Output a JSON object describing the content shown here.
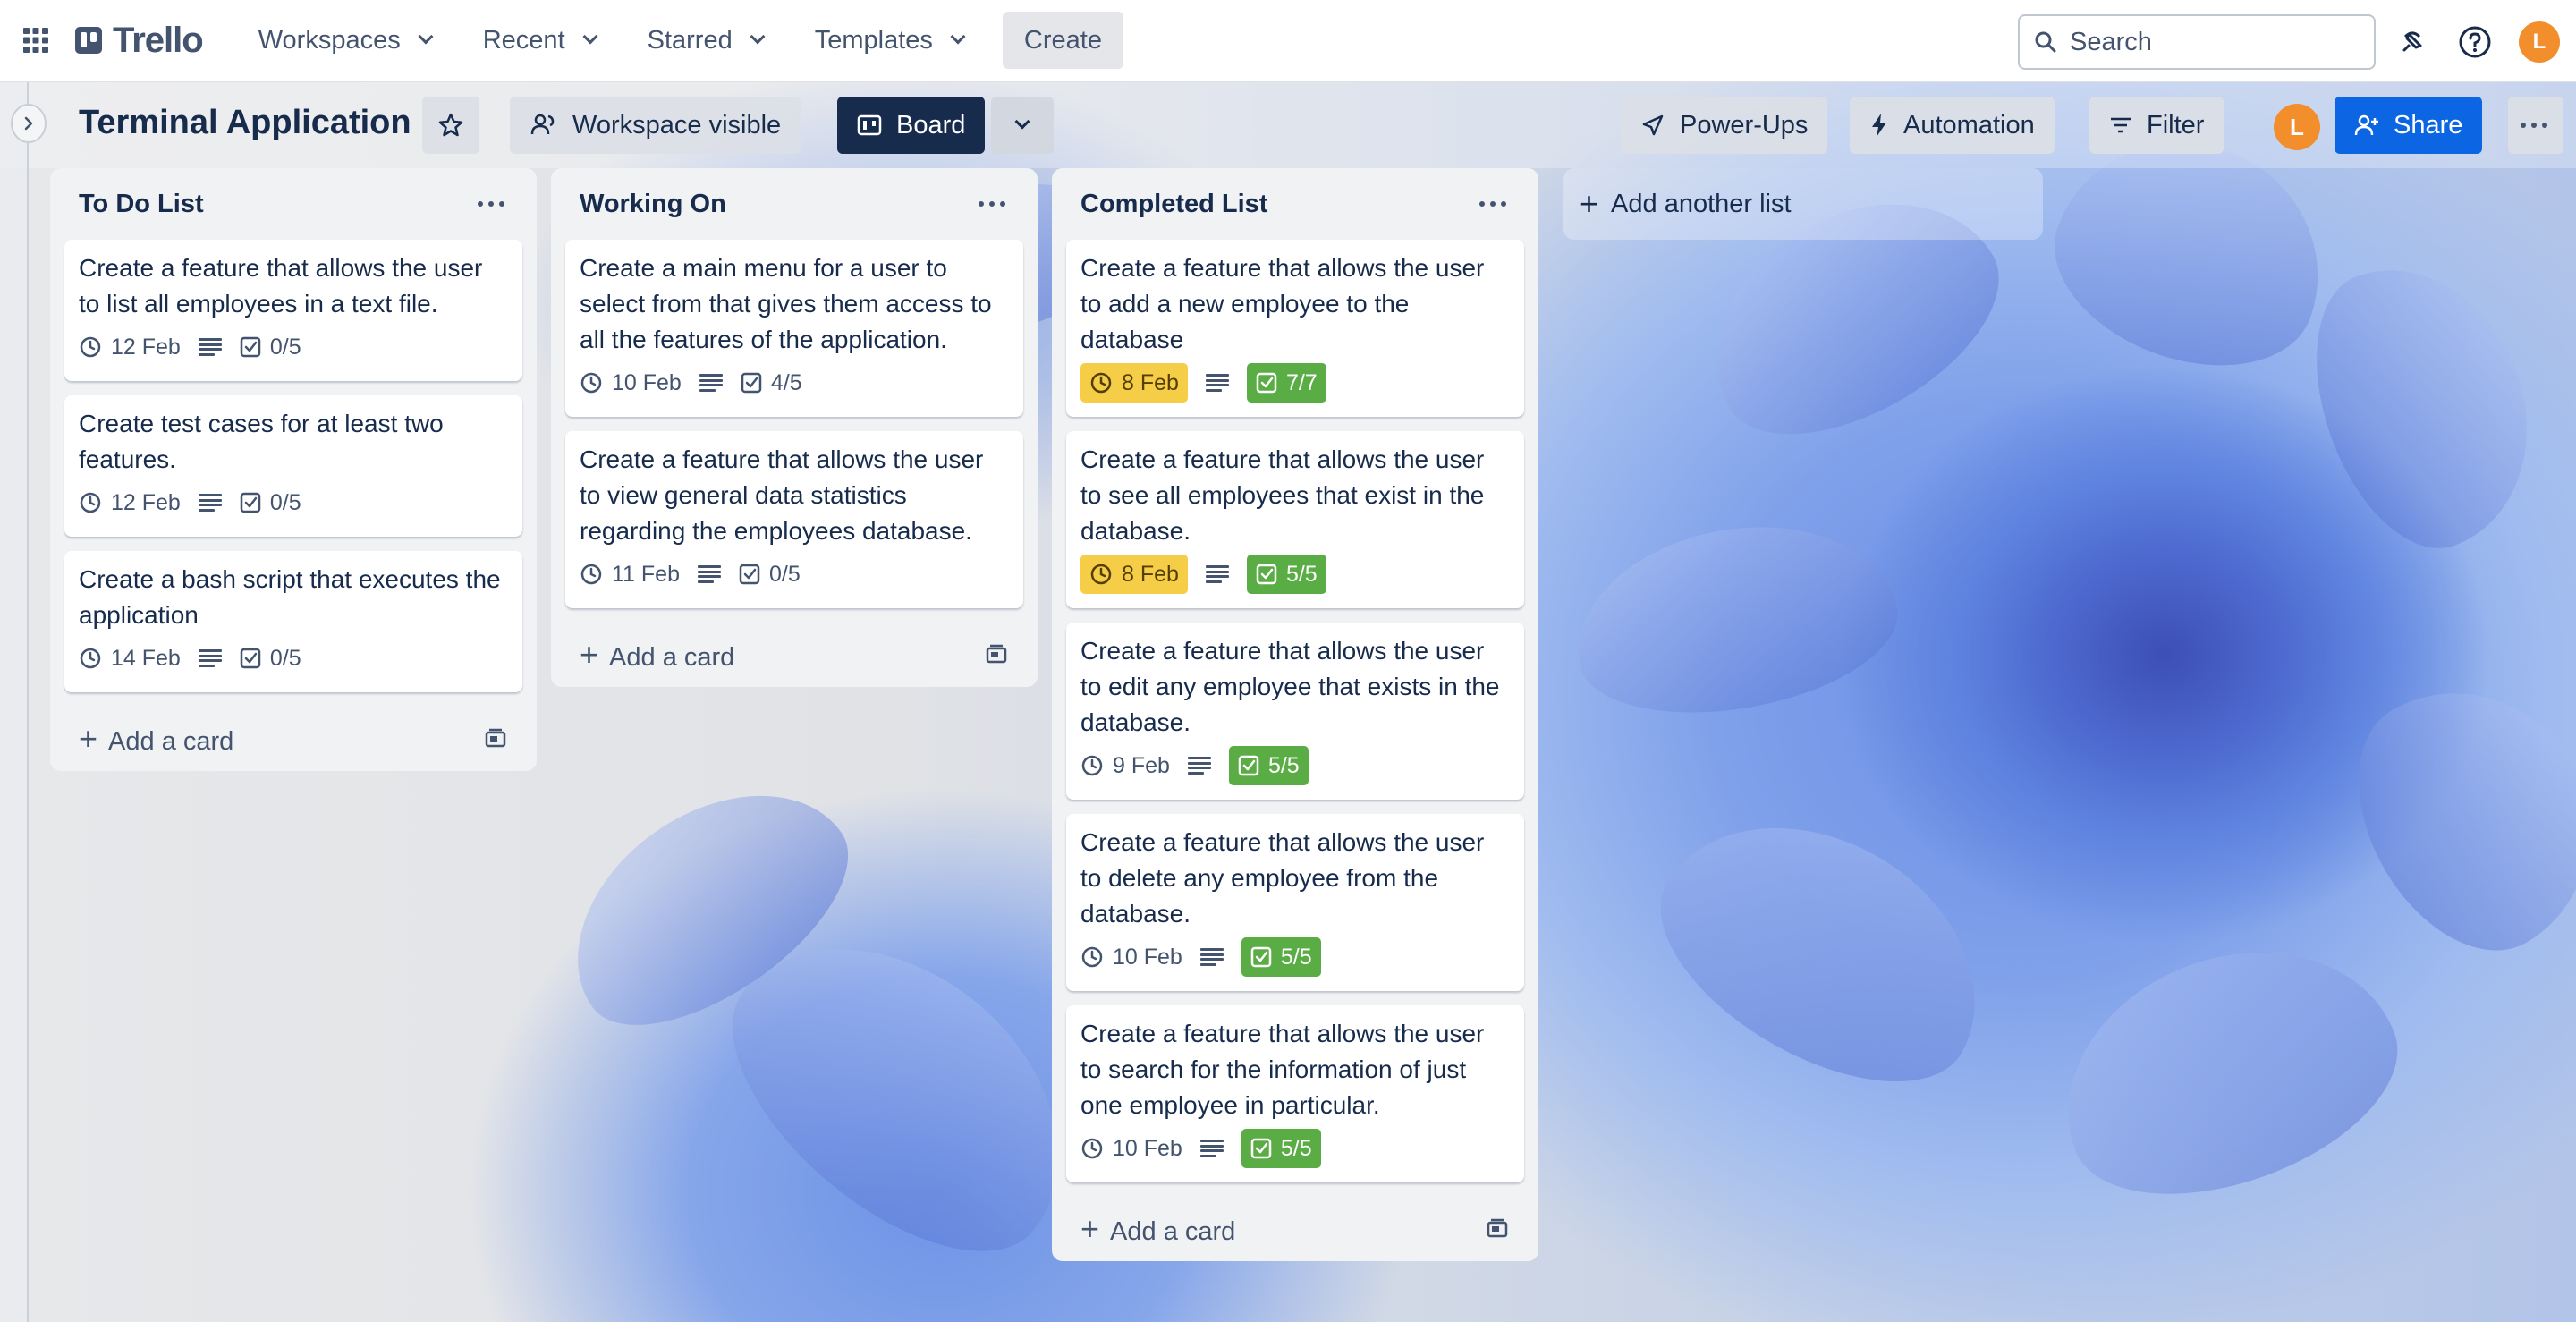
{
  "topbar": {
    "logo": "Trello",
    "nav": [
      "Workspaces",
      "Recent",
      "Starred",
      "Templates"
    ],
    "create": "Create",
    "search_placeholder": "Search",
    "avatar": "L"
  },
  "board": {
    "title": "Terminal Application",
    "visibility": "Workspace visible",
    "view": "Board",
    "power_ups": "Power-Ups",
    "automation": "Automation",
    "filter": "Filter",
    "share": "Share",
    "member_avatar": "L",
    "add_list": "Add another list"
  },
  "lists": [
    {
      "title": "To Do List",
      "add_card": "Add a card",
      "cards": [
        {
          "title": "Create a feature that allows the user to list all employees in a text file.",
          "due": "12 Feb",
          "due_style": "none",
          "checklist": "0/5",
          "check_style": "none"
        },
        {
          "title": "Create test cases for at least two features.",
          "due": "12 Feb",
          "due_style": "none",
          "checklist": "0/5",
          "check_style": "none"
        },
        {
          "title": "Create a bash script that executes the application",
          "due": "14 Feb",
          "due_style": "none",
          "checklist": "0/5",
          "check_style": "none"
        }
      ]
    },
    {
      "title": "Working On",
      "add_card": "Add a card",
      "cards": [
        {
          "title": "Create a main menu for a user to select from that gives them access to all the features of the application.",
          "due": "10 Feb",
          "due_style": "none",
          "checklist": "4/5",
          "check_style": "none"
        },
        {
          "title": "Create a feature that allows the user to view general data statistics regarding the employees database.",
          "due": "11 Feb",
          "due_style": "none",
          "checklist": "0/5",
          "check_style": "none"
        }
      ]
    },
    {
      "title": "Completed List",
      "add_card": "Add a card",
      "cards": [
        {
          "title": "Create a feature that allows the user to add a new employee to the database",
          "due": "8 Feb",
          "due_style": "yellow",
          "checklist": "7/7",
          "check_style": "green"
        },
        {
          "title": "Create a feature that allows the user to see all employees that exist in the database.",
          "due": "8 Feb",
          "due_style": "yellow",
          "checklist": "5/5",
          "check_style": "green"
        },
        {
          "title": "Create a feature that allows the user to edit any employee that exists in the database.",
          "due": "9 Feb",
          "due_style": "none",
          "checklist": "5/5",
          "check_style": "green"
        },
        {
          "title": "Create a feature that allows the user to delete any employee from the database.",
          "due": "10 Feb",
          "due_style": "none",
          "checklist": "5/5",
          "check_style": "green"
        },
        {
          "title": "Create a feature that allows the user to search for the information of just one employee in particular.",
          "due": "10 Feb",
          "due_style": "none",
          "checklist": "5/5",
          "check_style": "green"
        }
      ]
    }
  ],
  "colors": {
    "yellow_due": "#f5cd47",
    "green_checklist": "#5aac44",
    "board_button": "#172b4d",
    "share_button": "#0c66e4",
    "avatar": "#f28f2c"
  }
}
